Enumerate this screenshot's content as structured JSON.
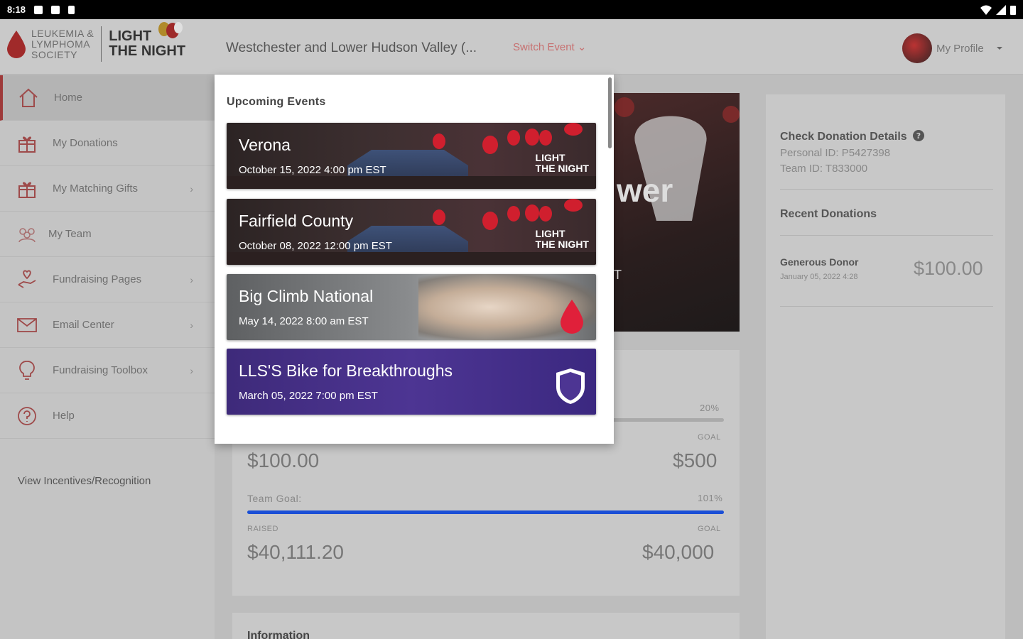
{
  "status_bar": {
    "time": "8:18"
  },
  "header": {
    "org_line1": "LEUKEMIA &",
    "org_line2": "LYMPHOMA",
    "org_line3": "SOCIETY",
    "brand_line1": "LIGHT",
    "brand_line2": "THE NIGHT",
    "event_name": "Westchester and Lower Hudson Valley (...",
    "switch_event": "Switch Event ⌄",
    "profile_label": "My Profile"
  },
  "sidebar": {
    "items": [
      {
        "label": "Home",
        "icon": "home-icon",
        "chevron": false
      },
      {
        "label": "My Donations",
        "icon": "gift-icon",
        "chevron": false
      },
      {
        "label": "My Matching Gifts",
        "icon": "gift-icon",
        "chevron": true
      },
      {
        "label": "My Team",
        "icon": "team-icon",
        "chevron": false
      },
      {
        "label": "Fundraising Pages",
        "icon": "hand-heart-icon",
        "chevron": true
      },
      {
        "label": "Email Center",
        "icon": "envelope-icon",
        "chevron": true
      },
      {
        "label": "Fundraising Toolbox",
        "icon": "lightbulb-icon",
        "chevron": true
      },
      {
        "label": "Help",
        "icon": "help-icon",
        "chevron": false
      }
    ],
    "incentives": "View Incentives/Recognition"
  },
  "hero": {
    "big_text": "wer",
    "small_text": "T"
  },
  "goals": {
    "personal_percent": "20%",
    "personal_goal_label": "GOAL",
    "personal_raised": "$100.00",
    "personal_goal": "$500",
    "team_label": "Team Goal:",
    "team_percent": "101%",
    "raised_label": "RAISED",
    "team_goal_label": "GOAL",
    "team_raised": "$40,111.20",
    "team_goal": "$40,000"
  },
  "info_card": {
    "title": "Information"
  },
  "right_panel": {
    "check_title": "Check Donation Details",
    "personal_id": "Personal ID: P5427398",
    "team_id": "Team ID: T833000",
    "recent_title": "Recent Donations",
    "donor_name": "Generous Donor",
    "donor_date": "January 05, 2022 4:28",
    "donor_amount": "$100.00"
  },
  "dropdown": {
    "heading": "Upcoming Events",
    "events": [
      {
        "title": "Verona",
        "date": "October 15, 2022 4:00 pm EST",
        "theme": "light-the-night"
      },
      {
        "title": "Fairfield County",
        "date": "October 08, 2022 12:00 pm EST",
        "theme": "light-the-night"
      },
      {
        "title": "Big Climb National",
        "date": "May 14, 2022 8:00 am EST",
        "theme": "big-climb"
      },
      {
        "title": "LLS'S Bike for Breakthroughs",
        "date": "March 05, 2022 7:00 pm EST",
        "theme": "team-in-training"
      }
    ],
    "ltn_mark_line1": "LIGHT",
    "ltn_mark_line2": "THE NIGHT"
  },
  "colors": {
    "brand_red": "#d01f2e",
    "progress_blue": "#1a4fd6",
    "team_purple": "#4d3593"
  }
}
